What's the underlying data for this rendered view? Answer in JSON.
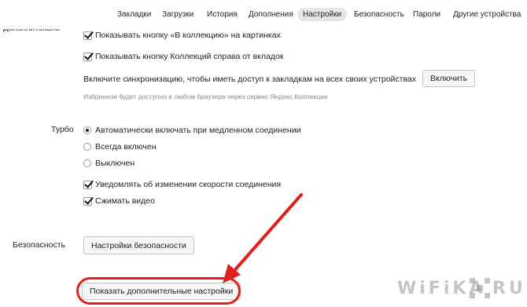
{
  "nav": {
    "tabs": [
      {
        "label": "Закладки",
        "active": false
      },
      {
        "label": "Загрузки",
        "active": false
      },
      {
        "label": "История",
        "active": false
      },
      {
        "label": "Дополнения",
        "active": false
      },
      {
        "label": "Настройки",
        "active": true
      },
      {
        "label": "Безопасность",
        "active": false
      },
      {
        "label": "Пароли",
        "active": false
      },
      {
        "label": "Другие устройства",
        "active": false
      }
    ]
  },
  "collections": {
    "section_label_cut": "Дополнительно",
    "show_collect_button": {
      "label": "Показывать кнопку «В коллекцию» на картинках",
      "checked": true
    },
    "show_collections_button": {
      "label": "Показывать кнопку Коллекций справа от вкладок",
      "checked": true
    },
    "sync_text": "Включите синхронизацию, чтобы иметь доступ к закладкам на всех своих устройствах",
    "sync_button": "Включить",
    "note": "Избранное будет доступно в любом браузере через сервис Яндекс.Коллекции"
  },
  "turbo": {
    "label": "Турбо",
    "options": [
      {
        "label": "Автоматически включать при медленном соединении",
        "selected": true
      },
      {
        "label": "Всегда включен",
        "selected": false
      },
      {
        "label": "Выключен",
        "selected": false
      }
    ],
    "notify": {
      "label": "Уведомлять об изменении скорости соединения",
      "checked": true
    },
    "compress_video": {
      "label": "Сжимать видео",
      "checked": true
    }
  },
  "security": {
    "label": "Безопасность",
    "button": "Настройки безопасности"
  },
  "show_more_button": "Показать дополнительные настройки",
  "watermark": {
    "text": "WiFiKA",
    "suffix": "RU"
  },
  "colors": {
    "highlight": "#e0201c",
    "active_tab_bg": "#e6e6e6"
  }
}
